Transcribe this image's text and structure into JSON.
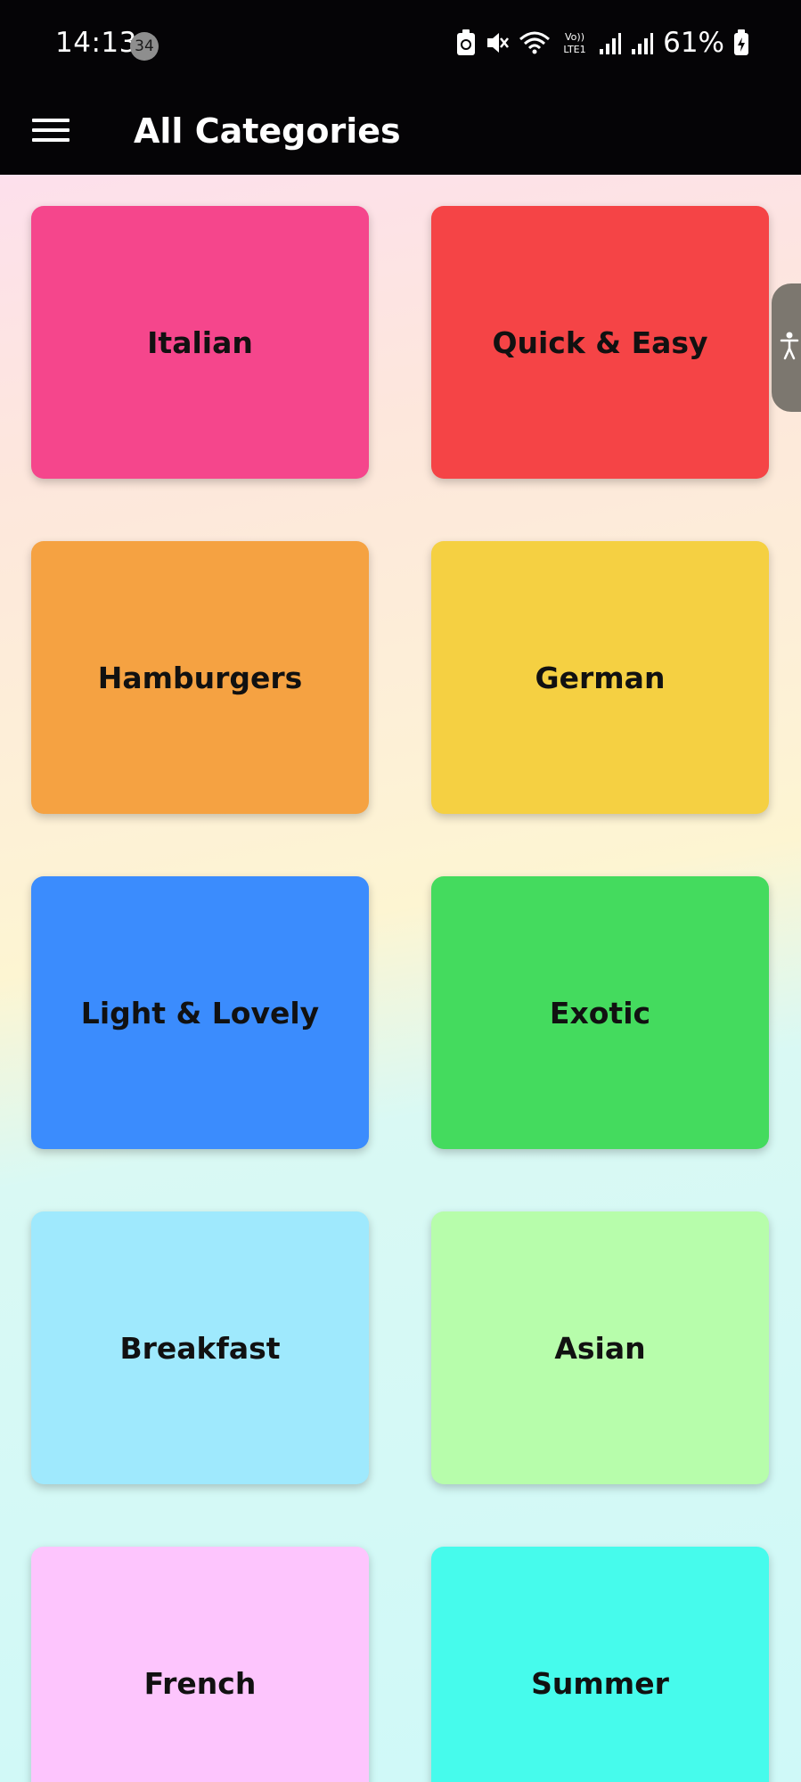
{
  "status_bar": {
    "time": "14:13",
    "notification_count": "34",
    "network_label": "Vo)) LTE1",
    "battery_percent": "61%",
    "icons": [
      "recycle-battery-icon",
      "mute-icon",
      "wifi-icon",
      "volte-icon",
      "signal-icon",
      "signal-icon",
      "battery-charging-icon"
    ]
  },
  "app_bar": {
    "menu_icon": "hamburger-menu-icon",
    "title": "All Categories"
  },
  "accessibility_tab": {
    "icon": "accessibility-icon"
  },
  "categories": [
    {
      "label": "Italian",
      "color": "#f5468c"
    },
    {
      "label": "Quick & Easy",
      "color": "#f54446"
    },
    {
      "label": "Hamburgers",
      "color": "#f5a242"
    },
    {
      "label": "German",
      "color": "#f5d042"
    },
    {
      "label": "Light & Lovely",
      "color": "#3b8cfd"
    },
    {
      "label": "Exotic",
      "color": "#44db5e"
    },
    {
      "label": "Breakfast",
      "color": "#9fe9fd"
    },
    {
      "label": "Asian",
      "color": "#b7fdab"
    },
    {
      "label": "French",
      "color": "#fdc5fd"
    },
    {
      "label": "Summer",
      "color": "#46fbec"
    }
  ]
}
